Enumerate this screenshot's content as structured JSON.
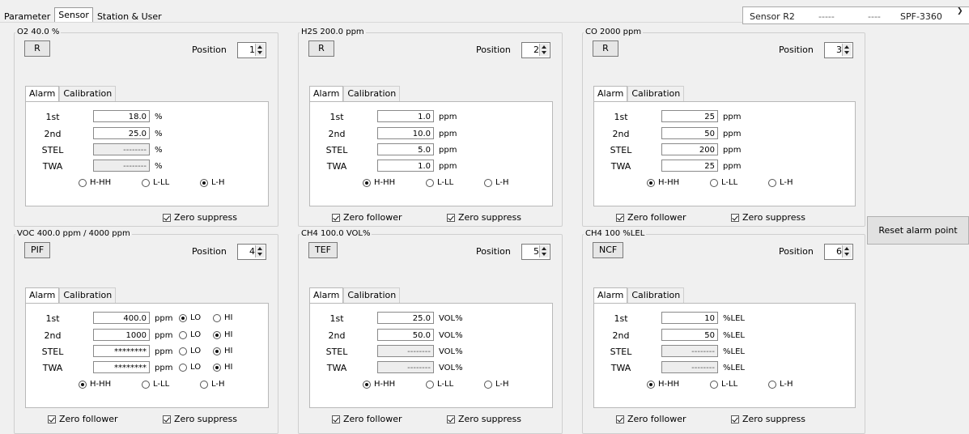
{
  "tabs": [
    "Parameter",
    "Sensor",
    "Station & User"
  ],
  "active_tab": "Sensor",
  "header": {
    "sensor": "Sensor R2",
    "dash1": "-----",
    "dash2": "----",
    "model": "SPF-3360"
  },
  "position_label": "Position",
  "calib_tab": "Calibration",
  "alarm_tab": "Alarm",
  "rows": [
    "1st",
    "2nd",
    "STEL",
    "TWA"
  ],
  "mode_labels": [
    "H-HH",
    "L-LL",
    "L-H"
  ],
  "zero_follower": "Zero follower",
  "zero_suppress": "Zero suppress",
  "reset_button": "Reset alarm point",
  "lohi": [
    "LO",
    "HI"
  ],
  "sensors": [
    {
      "title": "O2  40.0 %",
      "type": "R",
      "position": "1",
      "values": [
        "18.0",
        "25.0",
        "--------",
        "--------"
      ],
      "unit": "%",
      "disabled": [
        false,
        false,
        true,
        true
      ],
      "mode": 2,
      "zero_follower": null,
      "zero_suppress": true
    },
    {
      "title": "H2S  200.0 ppm",
      "type": "R",
      "position": "2",
      "values": [
        "1.0",
        "10.0",
        "5.0",
        "1.0"
      ],
      "unit": "ppm",
      "disabled": [
        false,
        false,
        false,
        false
      ],
      "mode": 0,
      "zero_follower": true,
      "zero_suppress": true
    },
    {
      "title": "CO  2000 ppm",
      "type": "R",
      "position": "3",
      "values": [
        "25",
        "50",
        "200",
        "25"
      ],
      "unit": "ppm",
      "disabled": [
        false,
        false,
        false,
        false
      ],
      "mode": 0,
      "zero_follower": true,
      "zero_suppress": true
    },
    {
      "title": "VOC  400.0 ppm  / 4000 ppm",
      "type": "PIF",
      "position": "4",
      "values": [
        "400.0",
        "1000",
        "********",
        "********"
      ],
      "unit": "ppm",
      "disabled": [
        false,
        false,
        false,
        false
      ],
      "lohi": [
        0,
        1,
        1,
        1
      ],
      "mode": 0,
      "zero_follower": true,
      "zero_suppress": true
    },
    {
      "title": "CH4  100.0 VOL%",
      "type": "TEF",
      "position": "5",
      "values": [
        "25.0",
        "50.0",
        "--------",
        "--------"
      ],
      "unit": "VOL%",
      "disabled": [
        false,
        false,
        true,
        true
      ],
      "mode": 0,
      "zero_follower": true,
      "zero_suppress": true
    },
    {
      "title": "CH4  100 %LEL",
      "type": "NCF",
      "position": "6",
      "values": [
        "10",
        "50",
        "--------",
        "--------"
      ],
      "unit": "%LEL",
      "disabled": [
        false,
        false,
        true,
        true
      ],
      "mode": 0,
      "zero_follower": true,
      "zero_suppress": true
    }
  ]
}
